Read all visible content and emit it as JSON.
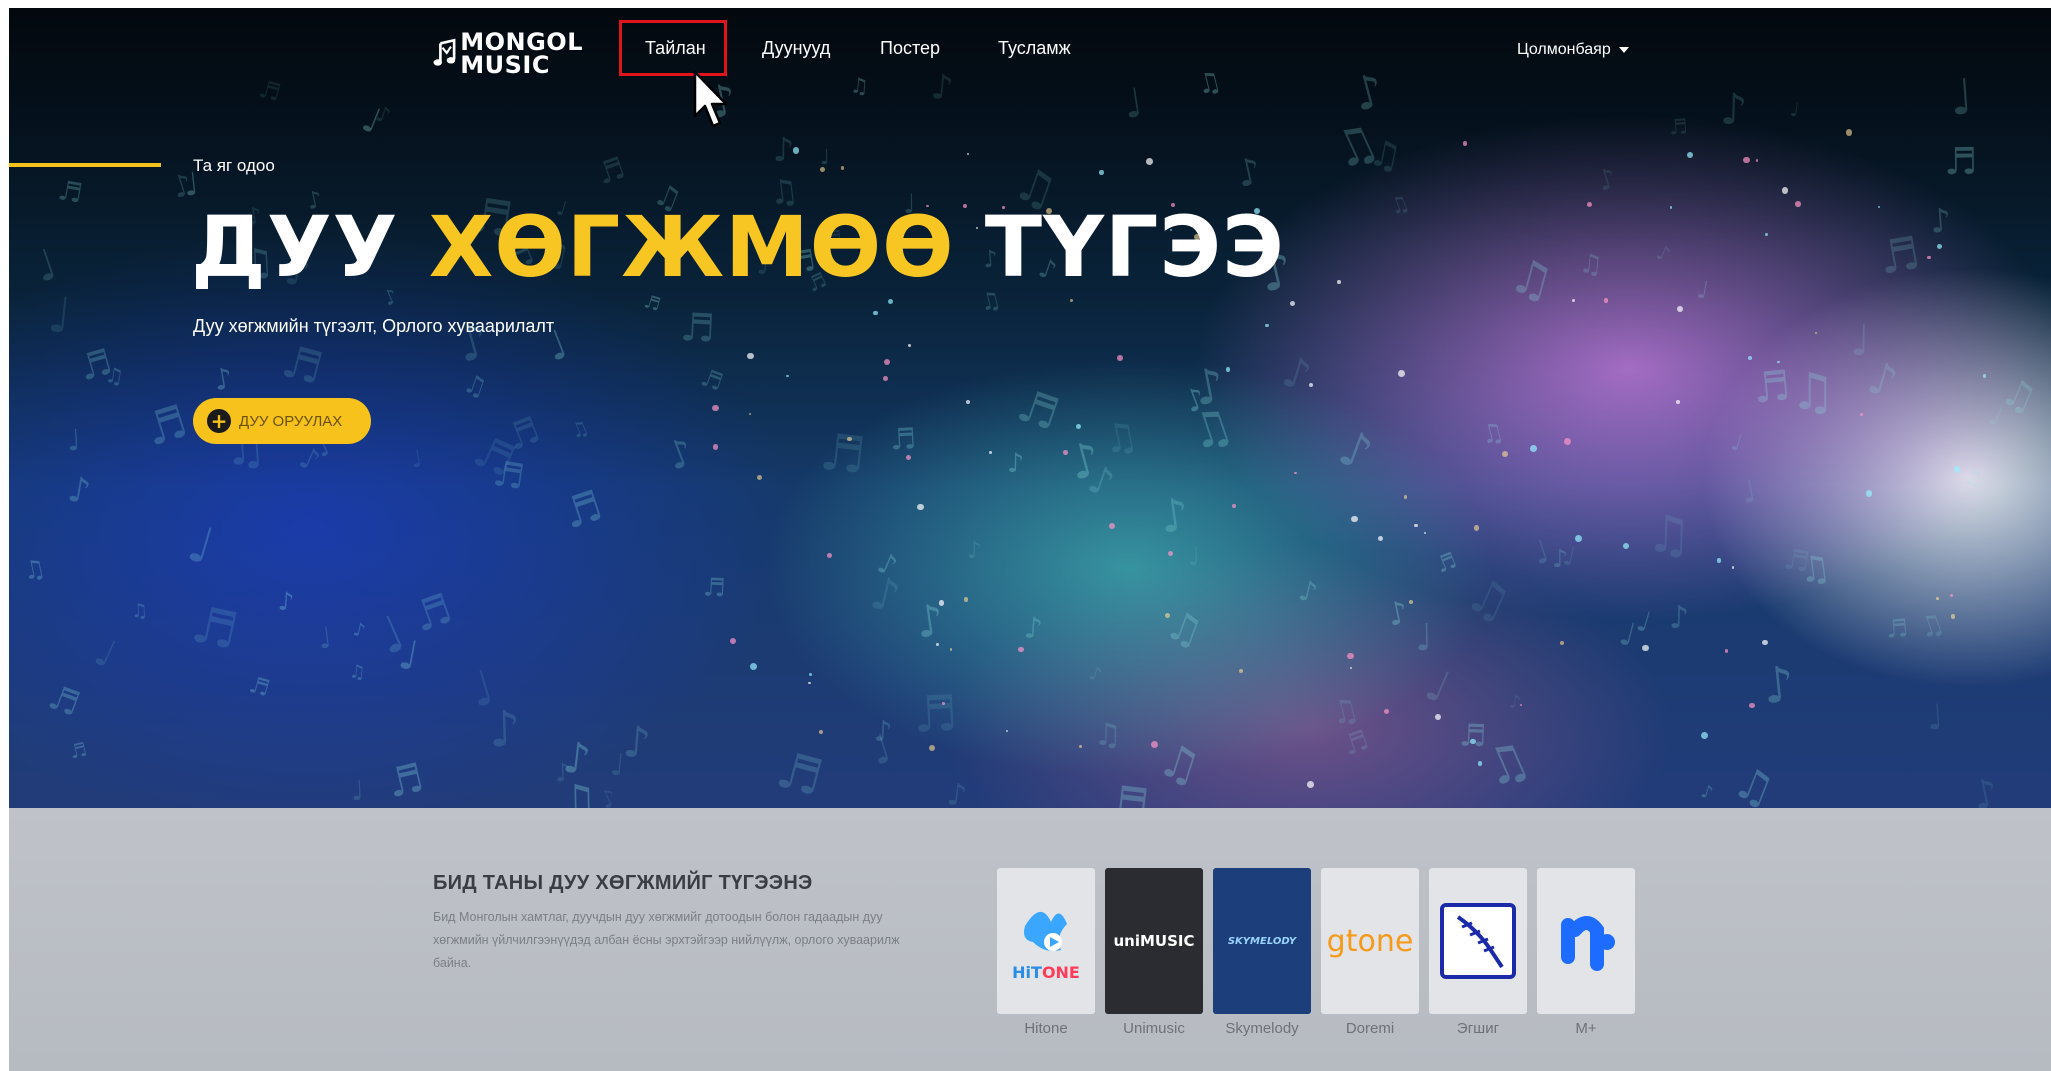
{
  "header": {
    "logo": {
      "line1": "MONGOL",
      "line2": "MUSIC"
    },
    "nav": [
      {
        "label": "Тайлан"
      },
      {
        "label": "Дуунууд"
      },
      {
        "label": "Постер"
      },
      {
        "label": "Тусламж"
      }
    ],
    "user": {
      "name": "Цолмонбаяр"
    }
  },
  "hero": {
    "eyebrow": "Та яг одоо",
    "headline": {
      "part1": "ДУУ",
      "part2": "ХӨГЖМӨӨ",
      "part3": "ТҮГЭЭ"
    },
    "subtitle": "Дуу хөгжмийн түгээлт, Орлого хуваарилалт",
    "cta": {
      "icon": "plus-circle-icon",
      "label": "ДУУ ОРУУЛАХ"
    }
  },
  "about": {
    "title": "БИД ТАНЫ ДУУ ХӨГЖМИЙГ ТҮГЭЭНЭ",
    "description": "Бид Монголын хамтлаг, дуучдын дуу хөгжмийг дотоодын болон гадаадын дуу хөгжмийн үйлчилгээнүүдэд албан ёсны эрхтэйгээр нийлүүлж, орлого хуваарилж байна."
  },
  "partners": [
    {
      "name": "Hitone",
      "logo_text": "HiTONE"
    },
    {
      "name": "Unimusic",
      "logo_text": "uniMUSIC"
    },
    {
      "name": "Skymelody",
      "logo_text": "SKYMELODY"
    },
    {
      "name": "Doremi",
      "logo_text": "gtone"
    },
    {
      "name": "Эгшиг",
      "logo_text": ""
    },
    {
      "name": "M+",
      "logo_text": ""
    }
  ],
  "colors": {
    "accent_yellow": "#f7c623",
    "highlight_red": "#e0151b",
    "lower_bg": "#bfc3c9"
  }
}
